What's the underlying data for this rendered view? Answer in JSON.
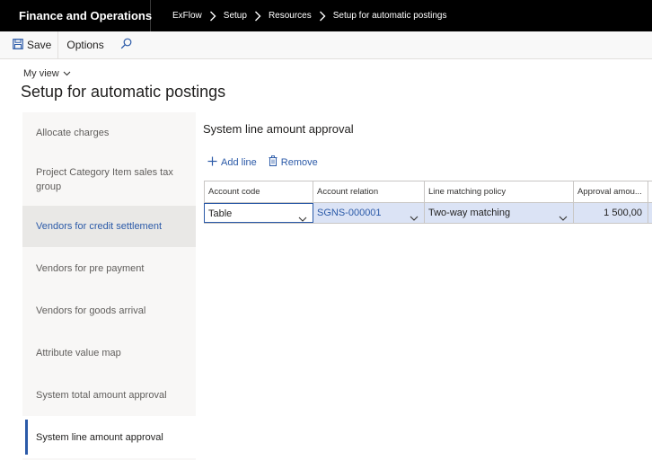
{
  "app": {
    "title": "Finance and Operations"
  },
  "breadcrumbs": [
    "ExFlow",
    "Setup",
    "Resources",
    "Setup for automatic postings"
  ],
  "actions": {
    "save_label": "Save",
    "options_label": "Options"
  },
  "header": {
    "view_label": "My view",
    "page_title": "Setup for automatic postings"
  },
  "nav": {
    "items": [
      {
        "label": "Allocate charges"
      },
      {
        "label": "Project Category Item sales tax group"
      },
      {
        "label": "Vendors for credit settlement"
      },
      {
        "label": "Vendors for pre payment"
      },
      {
        "label": "Vendors for goods arrival"
      },
      {
        "label": "Attribute value map"
      },
      {
        "label": "System total amount approval"
      },
      {
        "label": "System line amount approval"
      }
    ]
  },
  "section": {
    "title": "System line amount approval",
    "add_line_label": "Add line",
    "remove_label": "Remove"
  },
  "grid": {
    "columns": [
      "Account code",
      "Account relation",
      "Line matching policy",
      "Approval amou..."
    ],
    "rows": [
      {
        "account_code": "Table",
        "account_relation": "SGNS-000001",
        "line_matching_policy": "Two-way matching",
        "approval_amount": "1 500,00"
      }
    ]
  },
  "colors": {
    "accent": "#2b5aa8",
    "topbar": "#000000",
    "row_selected": "#dbe3f5"
  }
}
